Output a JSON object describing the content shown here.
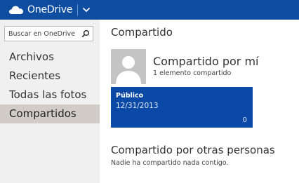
{
  "app": {
    "name": "OneDrive",
    "brand_color": "#0f4da0"
  },
  "sidebar": {
    "search": {
      "placeholder": "Buscar en OneDrive",
      "value": ""
    },
    "items": [
      {
        "label": "Archivos",
        "selected": false
      },
      {
        "label": "Recientes",
        "selected": false
      },
      {
        "label": "Todas las fotos",
        "selected": false
      },
      {
        "label": "Compartidos",
        "selected": true
      }
    ]
  },
  "main": {
    "title": "Compartido",
    "shared_by_me": {
      "heading": "Compartido por mí",
      "subtitle": "1 elemento compartido",
      "folder": {
        "name": "Público",
        "date": "12/31/2013",
        "count": "0",
        "color": "#0b49a6"
      }
    },
    "shared_by_others": {
      "heading": "Compartido por otras personas",
      "subtitle": "Nadie ha compartido nada contigo."
    }
  },
  "icons": {
    "brand": "cloud-icon",
    "menu": "chevron-down-icon",
    "search": "search-icon",
    "avatar": "person-silhouette-icon"
  }
}
